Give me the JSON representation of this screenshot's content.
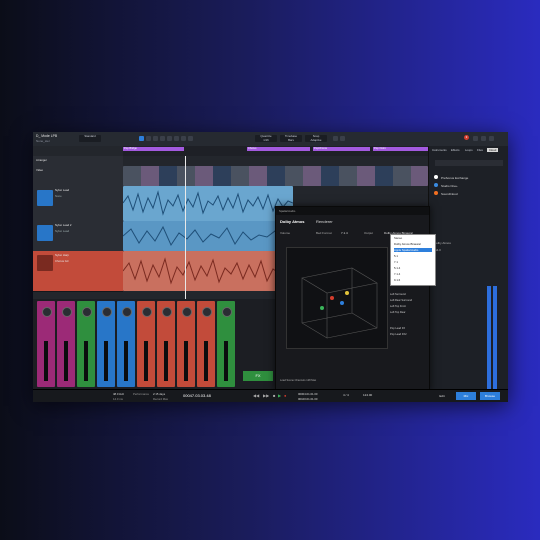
{
  "titlebar": {
    "title": "D_ Mode LPB",
    "subtitle": "None_ster",
    "dropdown": "Standard",
    "right_tabs": [
      "Instruments",
      "Effects",
      "Loops",
      "Files",
      "Cloud"
    ],
    "notification_count": "3"
  },
  "toolbar_groups": [
    {
      "top": "Quantize",
      "bottom": "1/16"
    },
    {
      "top": "Timebase",
      "bottom": "Bars"
    },
    {
      "top": "Snap",
      "bottom": "Adaptive"
    }
  ],
  "ruler_markers": [
    {
      "label": "Pop Bridge",
      "color": "#a35adf"
    },
    {
      "label": "Chorus",
      "color": "#a35adf"
    },
    {
      "label": "PopChorus",
      "color": "#a35adf"
    },
    {
      "label": "Pop Outro",
      "color": "#a35adf"
    }
  ],
  "tracks": [
    {
      "name": "Arranger",
      "color": "#3c3f46"
    },
    {
      "name": "Video",
      "color": "#3c3f46"
    },
    {
      "name": "Nylon Lead",
      "color": "#2876c8"
    },
    {
      "name": "Nylon Lead 2",
      "color": "#2876c8"
    },
    {
      "name": "Nylon Harp",
      "color": "#c24b3a"
    }
  ],
  "track_sublabels": {
    "mute": "None",
    "input": "Nylon Lead",
    "dist": "Chorus Gtr"
  },
  "mixer_fx_labels": [
    "FX",
    "FX",
    "FX"
  ],
  "renderer": {
    "header_title": "Dolby Atmos",
    "header_sub": "Renderer",
    "app_tab": "Spatial Audio",
    "volume_label": "Volume",
    "bed_format_label": "Bed Format",
    "bed_format_value": "7.1.4",
    "output_label": "Output",
    "output_value": "Dolby Atmos Binaural",
    "binaural_section": "Binaural mode",
    "bypass_label": "Bypass",
    "footer": "Load Scene Channels 128 Max",
    "dropdown_options": [
      "Stereo",
      "Dolby Atmos Binaural",
      "Apple Spatial Audio",
      "5.1",
      "7.1",
      "5.1.4",
      "7.1.4",
      "9.1.6"
    ],
    "selected_option": "Apple Spatial Audio",
    "channel_names": [
      "Left",
      "Right",
      "Center",
      "Left Surround",
      "Right Surround",
      "Left Rear Surround",
      "Right Rear Surround",
      "Left Top Front",
      "Right Top Front",
      "Left Top Rear",
      "Right Top Rear",
      "Pop Lead FX",
      "Pop Lead FX2"
    ]
  },
  "sidebar": {
    "items": [
      "PreSonus Exchange",
      "Studio One+",
      "SoundCloud"
    ],
    "level_label": "-64.0",
    "meter_label": "Dolby Atmos"
  },
  "transport": {
    "rate": "48.0 kHz",
    "latency": "14.0 ms",
    "performance": "Performance",
    "duration": "2:15 days",
    "remaining": "Record Max",
    "position": "00047.03.03.48",
    "left": "00004.01.01.00",
    "right": "00100.01.01.00",
    "signature": "4 / 4",
    "tempo": "124.00"
  },
  "bottom_buttons": [
    "Edit",
    "Mix",
    "Browse"
  ],
  "accent": "#2d7fdc"
}
